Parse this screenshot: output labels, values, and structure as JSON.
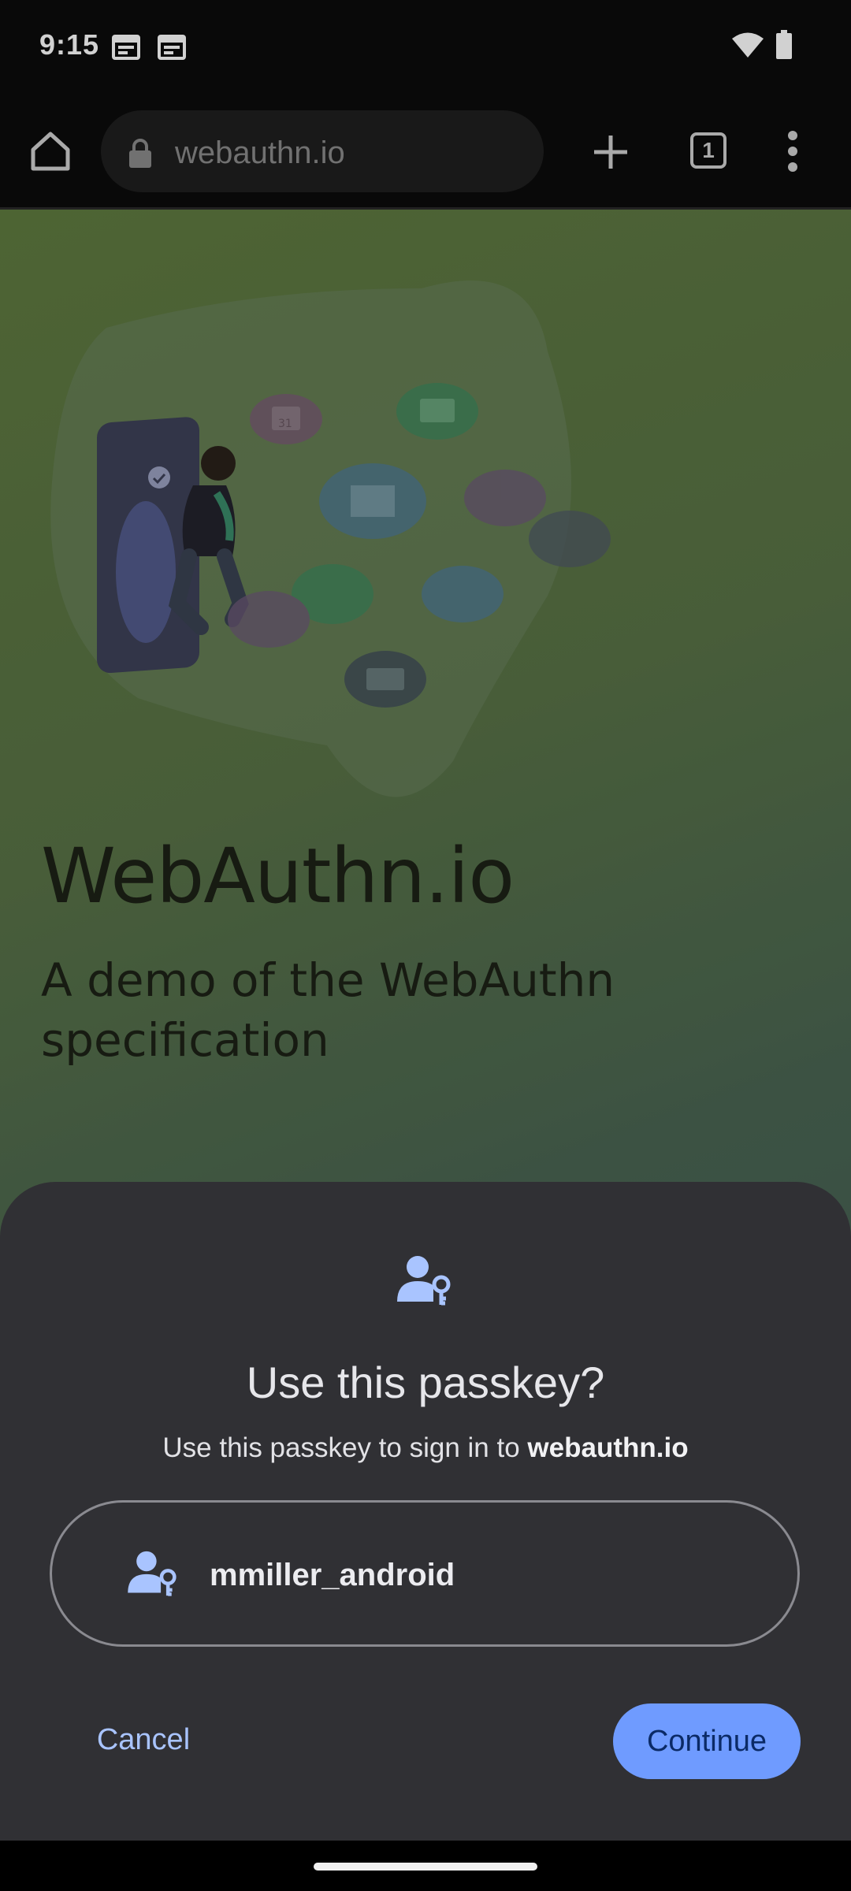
{
  "status_bar": {
    "time": "9:15",
    "icons": [
      "calendar-icon",
      "calendar-icon",
      "wifi-icon",
      "battery-icon"
    ]
  },
  "toolbar": {
    "url": "webauthn.io",
    "tab_count": "1",
    "icons": [
      "home-icon",
      "lock-icon",
      "plus-icon",
      "tabs-icon",
      "overflow-menu-icon"
    ]
  },
  "page": {
    "title": "WebAuthn.io",
    "subtitle": "A demo of the WebAuthn specification",
    "illustration": "person-stepping-out-of-phone-with-app-icons",
    "bubble_calendar_day": "31"
  },
  "sheet": {
    "icon": "passkey-icon",
    "title": "Use this passkey?",
    "subtitle_prefix": "Use this passkey to sign in to",
    "subtitle_domain": "webauthn.io",
    "account": {
      "icon": "passkey-icon",
      "name": "mmiller_android"
    },
    "cancel_label": "Cancel",
    "continue_label": "Continue"
  },
  "colors": {
    "sheet_bg": "#303034",
    "accent": "#6f9bff",
    "link": "#a9c4ff"
  }
}
